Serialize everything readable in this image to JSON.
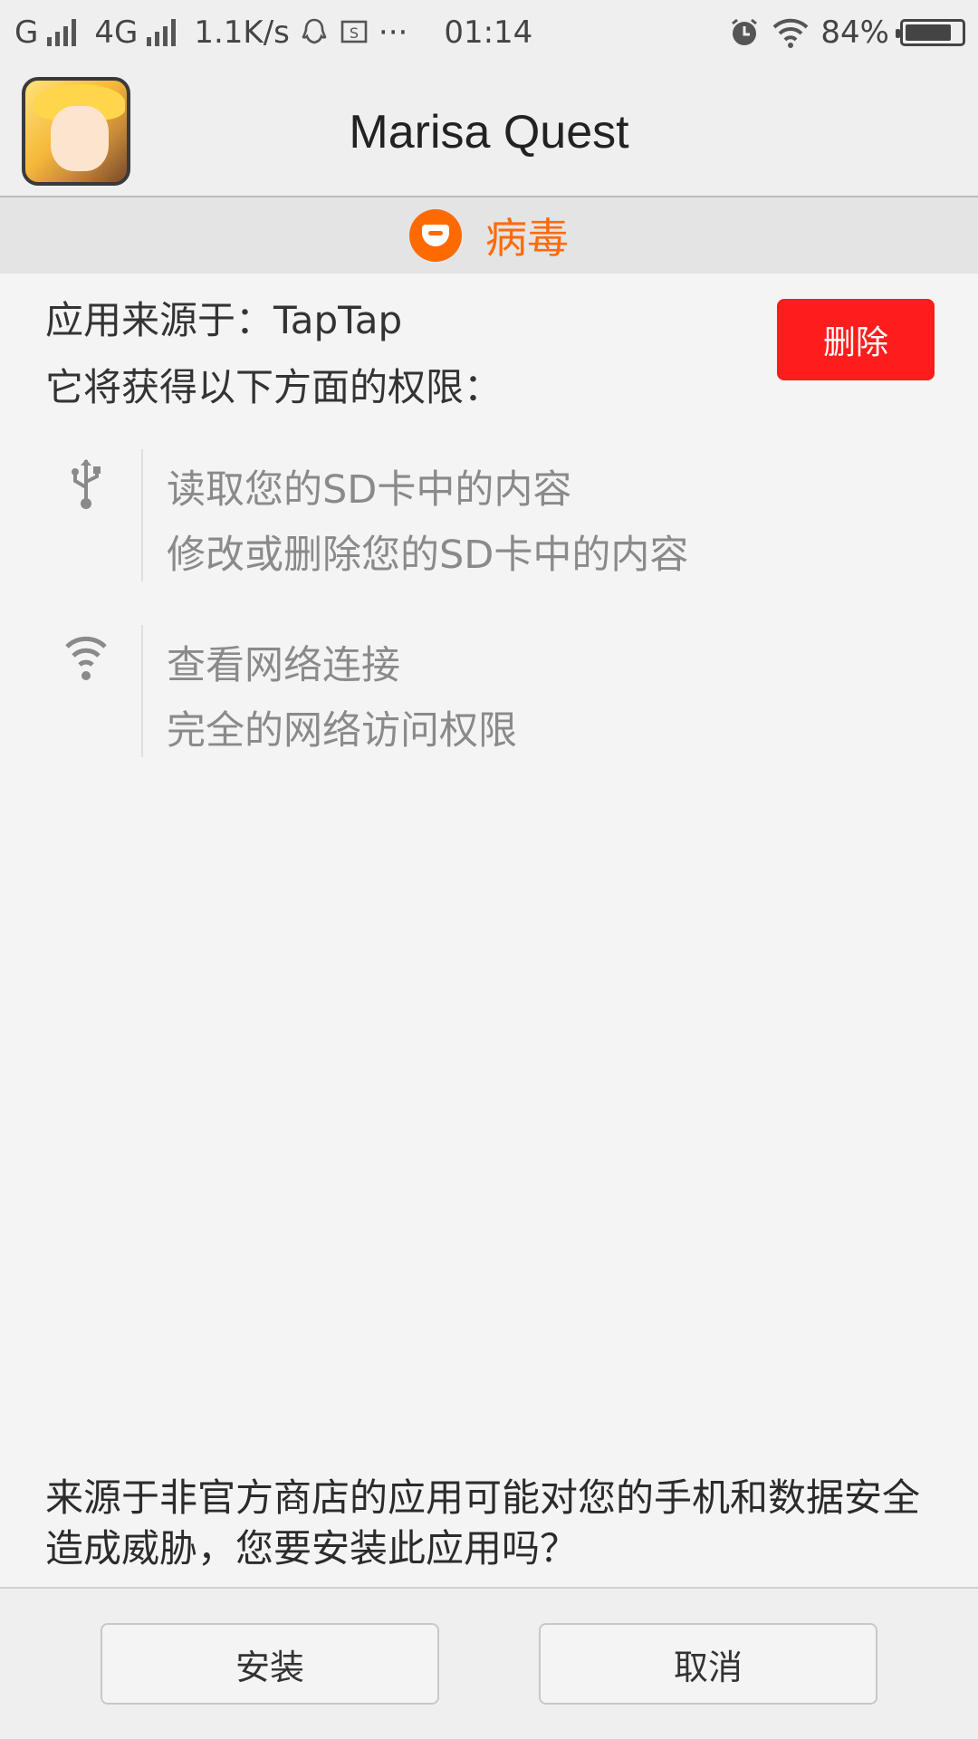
{
  "status_bar": {
    "network_left": "G",
    "network_right": "4G",
    "speed": "1.1K/s",
    "more": "···",
    "time": "01:14",
    "battery": "84%",
    "battery_level": 0.84
  },
  "header": {
    "app_title": "Marisa Quest"
  },
  "virus": {
    "label": "病毒",
    "color": "#ff6a0a"
  },
  "info": {
    "source": "应用来源于：TapTap",
    "permissions_intro": "它将获得以下方面的权限：",
    "delete_label": "删除"
  },
  "permissions": [
    {
      "icon": "usb-icon",
      "lines": [
        "读取您的SD卡中的内容",
        "修改或删除您的SD卡中的内容"
      ]
    },
    {
      "icon": "wifi-icon",
      "lines": [
        "查看网络连接",
        "完全的网络访问权限"
      ]
    }
  ],
  "warning": "来源于非官方商店的应用可能对您的手机和数据安全造成威胁，您要安装此应用吗？",
  "footer": {
    "install_label": "安装",
    "cancel_label": "取消"
  },
  "colors": {
    "delete_button": "#ff1c1c",
    "virus_badge": "#ff6a00"
  }
}
